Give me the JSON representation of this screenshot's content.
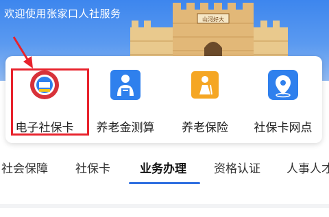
{
  "header": {
    "welcome": "欢迎使用张家口人社服务",
    "banner_sign": "山河好大"
  },
  "services": [
    {
      "label": "电子社保卡",
      "icon": "social-security-card-badge-icon"
    },
    {
      "label": "养老金测算",
      "icon": "person-calculator-icon"
    },
    {
      "label": "养老保险",
      "icon": "elderly-insurance-icon"
    },
    {
      "label": "社保卡网点",
      "icon": "location-pin-icon"
    }
  ],
  "tabs": [
    {
      "label": "社会保障"
    },
    {
      "label": "社保卡"
    },
    {
      "label": "业务办理",
      "active": true
    },
    {
      "label": "资格认证"
    },
    {
      "label": "人事人才"
    }
  ],
  "colors": {
    "banner": "#3d86ee",
    "accent": "#2f6fe0",
    "highlight": "#e8222c",
    "icon_blue": "#2f80ed",
    "icon_orange": "#f5a623"
  }
}
